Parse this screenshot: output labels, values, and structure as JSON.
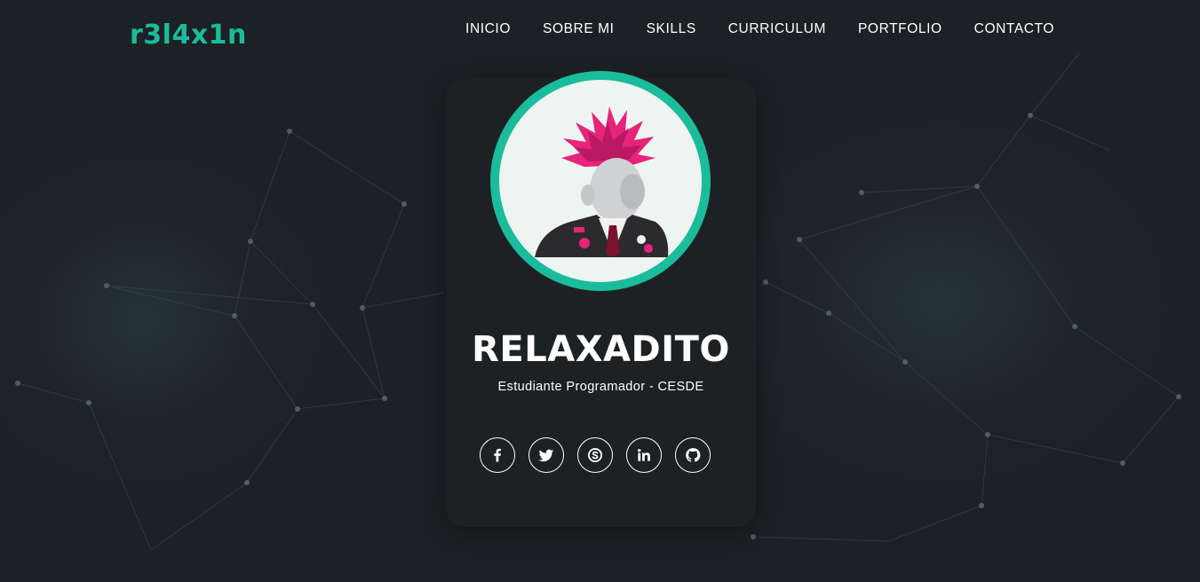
{
  "brand": {
    "logo_text": "r3l4x1n",
    "accent_color": "#1abc9c"
  },
  "nav": {
    "items": [
      {
        "label": "INICIO"
      },
      {
        "label": "SOBRE MI"
      },
      {
        "label": "SKILLS"
      },
      {
        "label": "CURRICULUM"
      },
      {
        "label": "PORTFOLIO"
      },
      {
        "label": "CONTACTO"
      }
    ]
  },
  "profile": {
    "name": "RELAXADITO",
    "subtitle": "Estudiante Programador - CESDE",
    "avatar_icon": "punk-mohawk-portrait"
  },
  "social": [
    {
      "icon": "facebook-icon"
    },
    {
      "icon": "twitter-icon"
    },
    {
      "icon": "skype-icon"
    },
    {
      "icon": "linkedin-icon"
    },
    {
      "icon": "github-icon"
    }
  ]
}
